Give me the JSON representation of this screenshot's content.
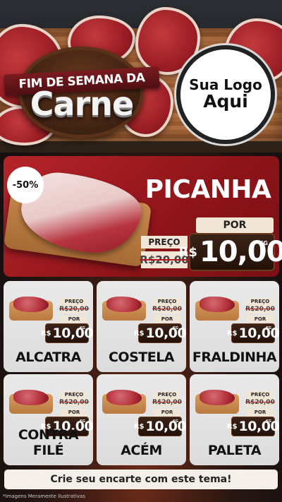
{
  "header": {
    "ribbon_text": "FIM DE SEMANA DA",
    "main_text": "Carne",
    "logo_line1": "Sua Logo",
    "logo_line2": "Aqui"
  },
  "featured": {
    "name": "PICANHA",
    "discount": "-50%",
    "price_label": "PREÇO",
    "old_price": "R$20,00",
    "por_label": "POR",
    "currency": "R$",
    "new_price": "10,00",
    "unit": "KG"
  },
  "products": [
    {
      "name": "ALCATRA",
      "price_label": "PREÇO",
      "old_price": "R$20,00",
      "por_label": "POR",
      "currency": "R$",
      "new_price": "10,00",
      "unit": "KG"
    },
    {
      "name": "COSTELA",
      "price_label": "PREÇO",
      "old_price": "R$20,00",
      "por_label": "POR",
      "currency": "R$",
      "new_price": "10,00",
      "unit": "KG"
    },
    {
      "name": "FRALDINHA",
      "price_label": "PREÇO",
      "old_price": "R$20,00",
      "por_label": "POR",
      "currency": "R$",
      "new_price": "10,00",
      "unit": "KG"
    },
    {
      "name": "CONTRA FILÉ",
      "price_label": "PREÇO",
      "old_price": "R$20,00",
      "por_label": "POR",
      "currency": "R$",
      "new_price": "10,00",
      "unit": "KG"
    },
    {
      "name": "ACÉM",
      "price_label": "PREÇO",
      "old_price": "R$20,00",
      "por_label": "POR",
      "currency": "R$",
      "new_price": "10,00",
      "unit": "KG"
    },
    {
      "name": "PALETA",
      "price_label": "PREÇO",
      "old_price": "R$20,00",
      "por_label": "POR",
      "currency": "R$",
      "new_price": "10,00",
      "unit": "KG"
    }
  ],
  "footer": {
    "cta": "Crie seu encarte com este tema!",
    "disclaimer": "*Imagens Meramente Ilustrativas"
  },
  "colors": {
    "accent_red": "#b5242a",
    "price_brown": "#2e1a10",
    "tag_cream": "#f1e5d6"
  }
}
